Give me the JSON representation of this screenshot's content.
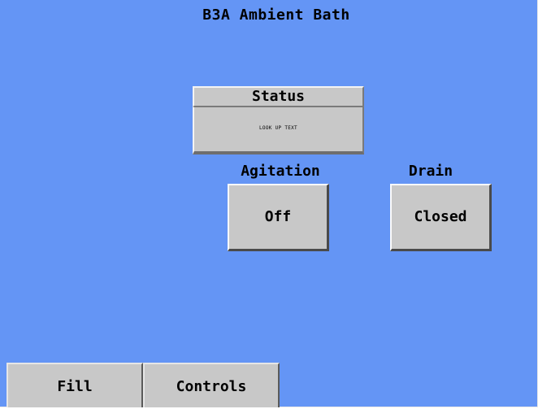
{
  "screen": {
    "title": "B3A Ambient Bath",
    "background_color": "#6495f5"
  },
  "status": {
    "header": "Status",
    "value": "LOOK UP TEXT"
  },
  "agitation": {
    "label": "Agitation",
    "value": "Off"
  },
  "drain": {
    "label": "Drain",
    "value": "Closed"
  },
  "nav": {
    "fill_label": "Fill",
    "controls_label": "Controls"
  },
  "colors": {
    "panel_gray": "#c8c8c8",
    "text": "#000000"
  }
}
